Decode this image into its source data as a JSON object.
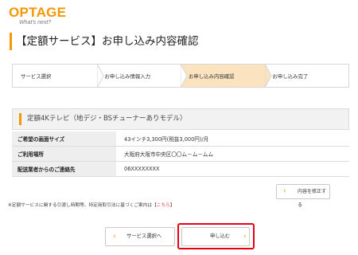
{
  "header": {
    "logo_text": "OPTAGE",
    "logo_tagline": "What's next?",
    "page_title": "【定額サービス】お申し込み内容確認"
  },
  "steps": [
    {
      "label": "サービス選択",
      "active": false
    },
    {
      "label": "お申し込み情報入力",
      "active": false
    },
    {
      "label": "お申し込み内容確認",
      "active": true
    },
    {
      "label": "お申し込み完了",
      "active": false
    }
  ],
  "plan": {
    "title": "定額4Kテレビ（地デジ・BSチューナーありモデル）"
  },
  "details": [
    {
      "label": "ご希望の画面サイズ",
      "value": "43インチ3,300円(税抜3,000円)/月"
    },
    {
      "label": "ご利用場所",
      "value": "大阪府大阪市中央区〇〇ム－ム－ムム"
    },
    {
      "label": "配送業者からのご連絡先",
      "value": "06XXXXXXXX"
    }
  ],
  "buttons": {
    "edit": "内容を修正する",
    "back": "サービス選択へ",
    "submit": "申し込む"
  },
  "notice": {
    "text": "※定額サービスに関する引渡し時期等、特定商取引法に基づくご案内は",
    "link_open": "【",
    "link_text": "こちら",
    "link_close": "】"
  },
  "colors": {
    "accent": "#f39800",
    "active_step": "#fbe3bf",
    "highlight": "#e60012"
  }
}
